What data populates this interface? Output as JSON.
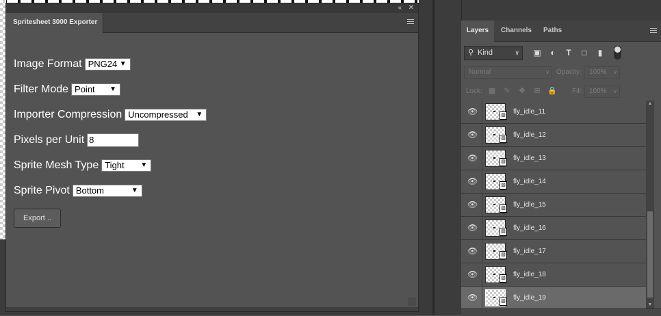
{
  "exporter": {
    "title": "Spritesheet 3000 Exporter",
    "collapse_icon": "double-chevron-icon",
    "close_icon": "close-icon",
    "fields": [
      {
        "label": "Image Format",
        "value": "PNG24"
      },
      {
        "label": "Filter Mode",
        "value": "Point"
      },
      {
        "label": "Importer Compression",
        "value": "Uncompressed"
      },
      {
        "label": "Pixels per Unit",
        "value": "8"
      },
      {
        "label": "Sprite Mesh Type",
        "value": "Tight"
      },
      {
        "label": "Sprite Pivot",
        "value": "Bottom"
      }
    ],
    "export_label": "Export .."
  },
  "layers_panel": {
    "tabs": [
      "Layers",
      "Channels",
      "Paths"
    ],
    "active_tab": "Layers",
    "filter_kind": "Kind",
    "blend_mode": "Normal",
    "opacity_label": "Opacity:",
    "opacity_value": "100%",
    "lock_label": "Lock:",
    "fill_label": "Fill:",
    "fill_value": "100%",
    "layers": [
      {
        "name": "fly_idle_11",
        "visible": true,
        "selected": false
      },
      {
        "name": "fly_idle_12",
        "visible": true,
        "selected": false
      },
      {
        "name": "fly_idle_13",
        "visible": true,
        "selected": false
      },
      {
        "name": "fly_idle_14",
        "visible": true,
        "selected": false
      },
      {
        "name": "fly_idle_15",
        "visible": true,
        "selected": false
      },
      {
        "name": "fly_idle_16",
        "visible": true,
        "selected": false
      },
      {
        "name": "fly_idle_17",
        "visible": true,
        "selected": false
      },
      {
        "name": "fly_idle_18",
        "visible": true,
        "selected": false
      },
      {
        "name": "fly_idle_19",
        "visible": true,
        "selected": true
      }
    ]
  }
}
